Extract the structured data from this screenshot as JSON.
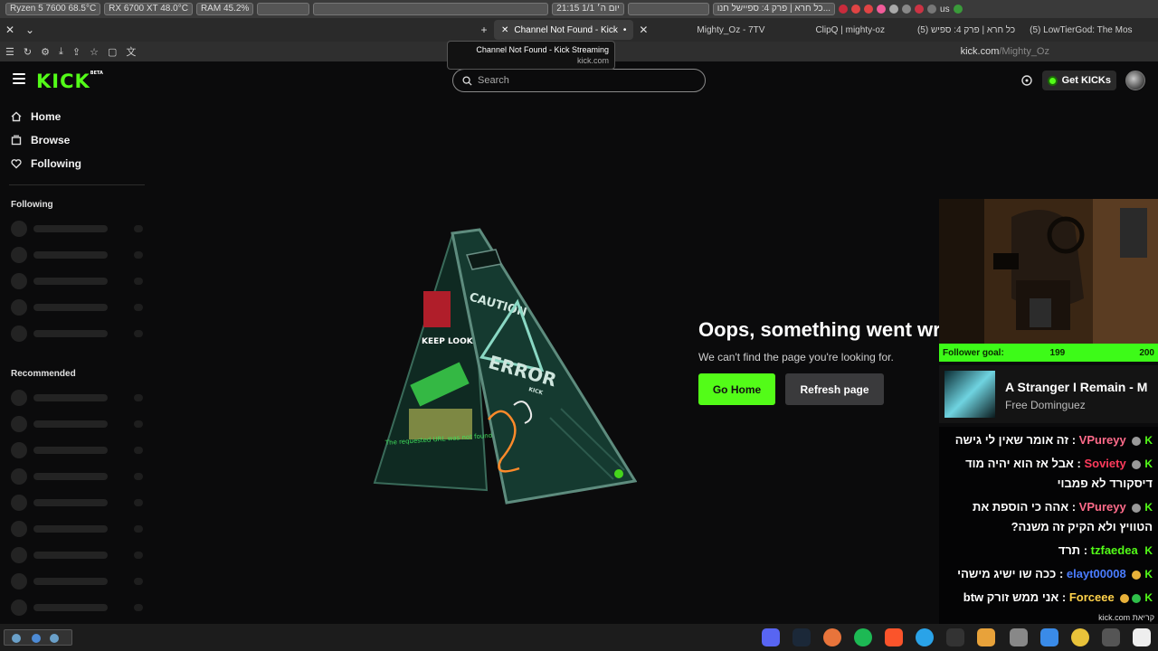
{
  "system_panel": {
    "cpu": "Ryzen 5 7600  68.5°C",
    "gpu": "RX 6700 XT 48.0°C",
    "ram": "RAM   45.2%",
    "clock": "21:15 יום ה׳ 1/1",
    "media": "כל חרא | פרק 4: ספיישל חנו...",
    "lang": "us"
  },
  "browser": {
    "tabs": [
      {
        "title": "Channel Not Found - Kick",
        "active": true
      },
      {
        "title": "Mighty_Oz - 7TV",
        "active": false
      },
      {
        "title": "ClipQ | mighty-oz",
        "active": false
      },
      {
        "title": "(5) כל חרא | פרק 4: ספיש",
        "active": false
      },
      {
        "title": "(5) LowTierGod: The Mos",
        "active": false
      }
    ],
    "url_host": "kick.com",
    "url_path": "/Mighty_Oz",
    "tooltip_title": "Channel Not Found - Kick Streaming",
    "tooltip_sub": "kick.com"
  },
  "header": {
    "logo": "KICK",
    "logo_badge": "BETA",
    "search_placeholder": "Search",
    "get_kicks": "Get KICKs"
  },
  "sidebar": {
    "nav": [
      {
        "label": "Home",
        "icon": "home-icon"
      },
      {
        "label": "Browse",
        "icon": "browse-icon"
      },
      {
        "label": "Following",
        "icon": "heart-icon"
      }
    ],
    "following_heading": "Following",
    "recommended_heading": "Recommended"
  },
  "error": {
    "title": "Oops, something went wrong",
    "subtitle": "We can't find the page you're looking for.",
    "home_button": "Go Home",
    "refresh_button": "Refresh page",
    "sign_top": "CAUTION",
    "sign_main": "ERROR",
    "sign_brand": "KICK",
    "sign_keep": "KEEP LOOKIN'",
    "sign_footer": "The requested URL was not found"
  },
  "overlay": {
    "follower_goal_label": "Follower goal:",
    "follower_current": "199",
    "follower_target": "200",
    "song_title": "A Stranger I Remain - M",
    "song_artist": "Free Dominguez",
    "chat": [
      {
        "user": "VPureyy",
        "color": "#ff6b8a",
        "text": "זה אומר שאין לי גישה"
      },
      {
        "user": "Soviety",
        "color": "#ff3b5c",
        "text": "אבל אז הוא יהיה מוד דיסקורד לא פמבוי"
      },
      {
        "user": "VPureyy",
        "color": "#ff6b8a",
        "text": "אהה כי הוספת את הטוויץ ולא הקיק זה משנה?"
      },
      {
        "user": "tzfaedea",
        "color": "#53fc18",
        "text": "תרד"
      },
      {
        "user": "elayt00008",
        "color": "#4a7cff",
        "text": "ככה שו ישיג מישהי"
      },
      {
        "user": "Forceee",
        "color": "#ffd24a",
        "text": "אני ממש זורק btw"
      }
    ],
    "watermark": "קריאת kick.com"
  }
}
